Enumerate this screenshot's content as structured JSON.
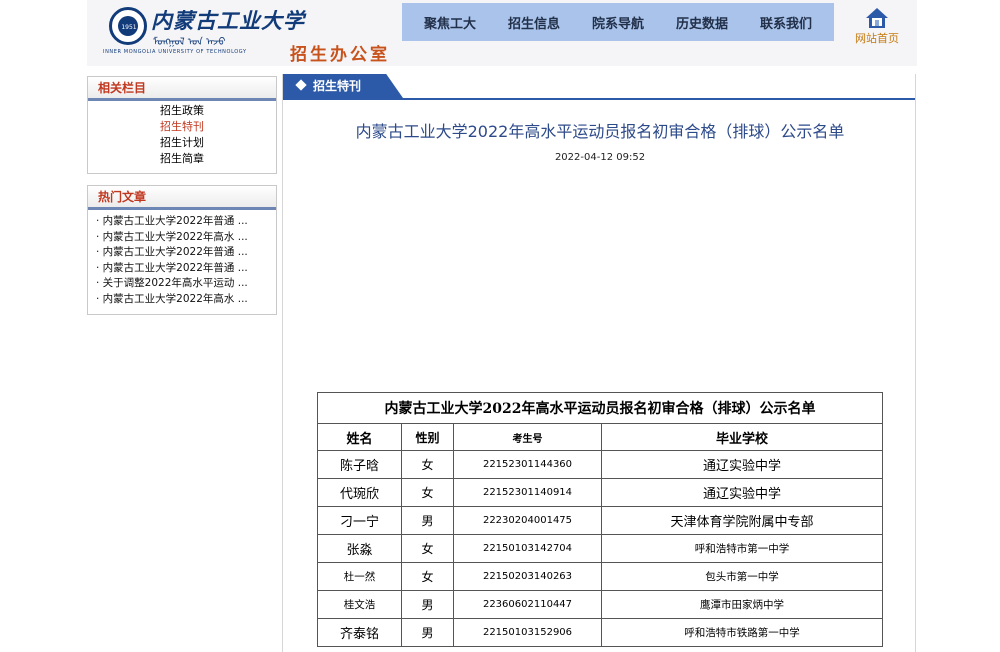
{
  "header": {
    "logo_cn": "内蒙古工业大学",
    "logo_seal": "1951",
    "logo_mongolian": "ᠮᠣᠩᠭᠣᠯ ᠤᠨ ᠠᠵᠤ",
    "logo_en": "INNER MONGOLIA UNIVERSITY OF TECHNOLOGY",
    "brand": "招生办公室",
    "home_label": "网站首页"
  },
  "nav": [
    "聚焦工大",
    "招生信息",
    "院系导航",
    "历史数据",
    "联系我们"
  ],
  "sidebar": {
    "related_title": "相关栏目",
    "related_items": [
      {
        "label": "招生政策",
        "active": false
      },
      {
        "label": "招生特刊",
        "active": true
      },
      {
        "label": "招生计划",
        "active": false
      },
      {
        "label": "招生简章",
        "active": false
      }
    ],
    "hot_title": "热门文章",
    "hot_items": [
      "· 内蒙古工业大学2022年普通 ...",
      "· 内蒙古工业大学2022年高水 ...",
      "· 内蒙古工业大学2022年普通 ...",
      "· 内蒙古工业大学2022年普通 ...",
      "· 关于调整2022年高水平运动 ...",
      "· 内蒙古工业大学2022年高水 ..."
    ]
  },
  "article": {
    "section": "招生特刊",
    "title": "内蒙古工业大学2022年高水平运动员报名初审合格（排球）公示名单",
    "date": "2022-04-12 09:52",
    "table_caption": "内蒙古工业大学2022年高水平运动员报名初审合格（排球）公示名单",
    "columns": [
      "姓名",
      "性别",
      "考生号",
      "毕业学校"
    ],
    "rows": [
      [
        "陈子晗",
        "女",
        "22152301144360",
        "通辽实验中学"
      ],
      [
        "代琬欣",
        "女",
        "22152301140914",
        "通辽实验中学"
      ],
      [
        "刁一宁",
        "男",
        "22230204001475",
        "天津体育学院附属中专部"
      ],
      [
        "张淼",
        "女",
        "22150103142704",
        "呼和浩特市第一中学"
      ],
      [
        "杜一然",
        "女",
        "22150203140263",
        "包头市第一中学"
      ],
      [
        "桂文浩",
        "男",
        "22360602110447",
        "鹰潭市田家炳中学"
      ],
      [
        "齐泰铭",
        "男",
        "22150103152906",
        "呼和浩特市铁路第一中学"
      ]
    ]
  },
  "colors": {
    "nav_bg": "#a9c3ea",
    "accent_blue": "#2d5aa8",
    "accent_red": "#c0381f",
    "brand_orange": "#c8521c",
    "home_orange": "#c47a10"
  }
}
